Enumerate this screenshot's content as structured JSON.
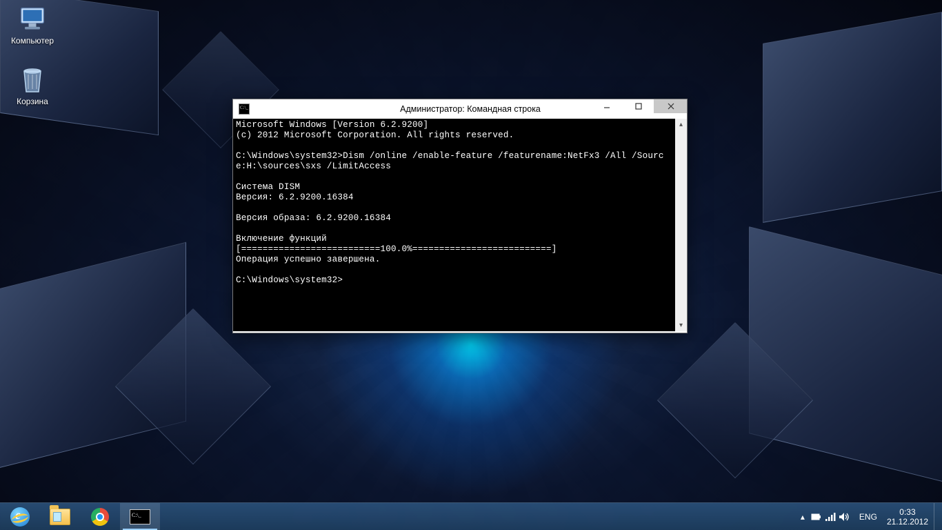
{
  "desktop": {
    "icons": {
      "computer": "Компьютер",
      "recycle_bin": "Корзина"
    }
  },
  "cmd_window": {
    "title": "Администратор: Командная строка",
    "lines": [
      "Microsoft Windows [Version 6.2.9200]",
      "(c) 2012 Microsoft Corporation. All rights reserved.",
      "",
      "C:\\Windows\\system32>Dism /online /enable-feature /featurename:NetFx3 /All /Sourc",
      "e:H:\\sources\\sxs /LimitAccess",
      "",
      "Cистема DISM",
      "Версия: 6.2.9200.16384",
      "",
      "Версия образа: 6.2.9200.16384",
      "",
      "Включение функций",
      "[==========================100.0%==========================]",
      "Операция успешно завершена.",
      "",
      "C:\\Windows\\system32>"
    ]
  },
  "taskbar": {
    "apps": {
      "ie": "Internet Explorer",
      "explorer": "Проводник",
      "chrome": "Google Chrome",
      "cmd": "Командная строка"
    },
    "tray": {
      "show_hidden": "▴",
      "power": "power-icon",
      "network": "network-icon",
      "volume": "volume-icon",
      "language": "ENG"
    },
    "clock": {
      "time": "0:33",
      "date": "21.12.2012"
    }
  }
}
